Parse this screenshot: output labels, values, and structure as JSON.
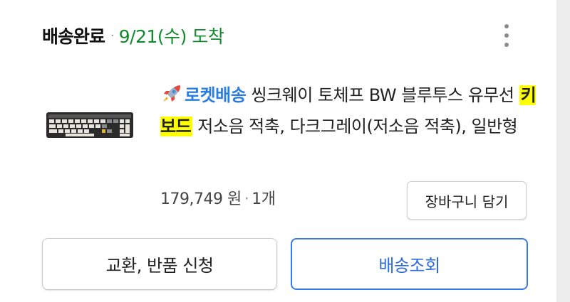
{
  "header": {
    "status": "배송완료",
    "separator": "·",
    "arrival": "9/21(수) 도착"
  },
  "product": {
    "badge_label": "로켓배송",
    "title_part1": "씽크웨이 토체프 BW 블루투스 유무선 ",
    "highlight": "키보드",
    "title_part2": " 저소음 적축, 다크그레이(저소음 적축), 일반형",
    "price": "179,749 원",
    "separator": "·",
    "quantity": "1개"
  },
  "buttons": {
    "cart": "장바구니 담기",
    "exchange": "교환, 반품 신청",
    "track": "배송조회"
  },
  "icons": {
    "more": "more-vertical-icon",
    "badge": "rocket-icon"
  },
  "colors": {
    "arrival": "#138a2e",
    "badge": "#2a7de1",
    "highlight": "#ffff00",
    "track_button": "#3b78e7"
  }
}
